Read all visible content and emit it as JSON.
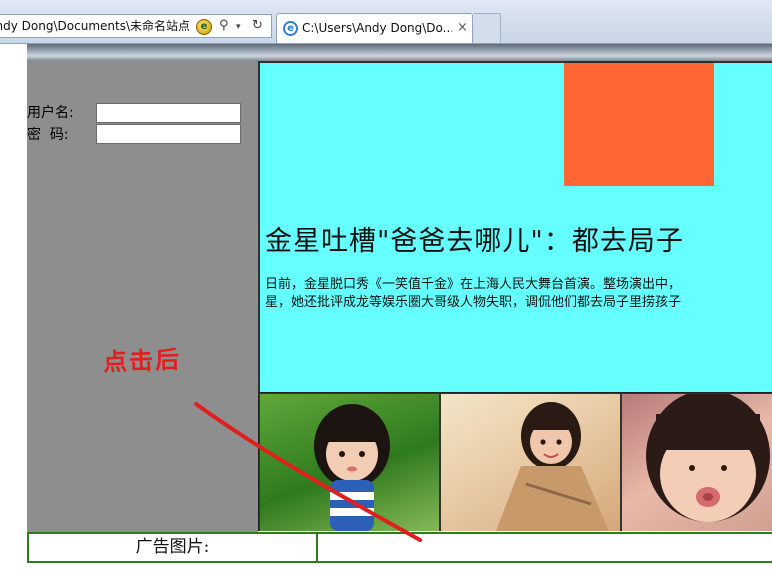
{
  "browser": {
    "address_text": "ndy Dong\\Documents\\未命名站点",
    "tab_title": "C:\\Users\\Andy Dong\\Do...",
    "tab_close": "×",
    "search_glyph": "⚲",
    "dropdown_glyph": "▾",
    "refresh_glyph": "↻",
    "compat_glyph": "e",
    "ie_glyph": "e"
  },
  "login": {
    "username_label": "用户名:",
    "password_label": "密  码:",
    "username_value": "",
    "password_value": ""
  },
  "article": {
    "headline": "金星吐槽\"爸爸去哪儿\"：都去局子",
    "line1": "日前，金星脱口秀《一笑值千金》在上海人民大舞台首演。整场演出中，",
    "line2": "星，她还批评成龙等娱乐圈大哥级人物失职，调侃他们都去局子里捞孩子"
  },
  "colors": {
    "main_panel": "#66ffff",
    "orange_box": "#ff6633",
    "sidebar": "#8e8e8e",
    "annotation": "#e01f1f",
    "ad_border": "#2e7d1d"
  },
  "ad": {
    "label": "广告图片:"
  },
  "annotation": {
    "text": "点击后"
  }
}
